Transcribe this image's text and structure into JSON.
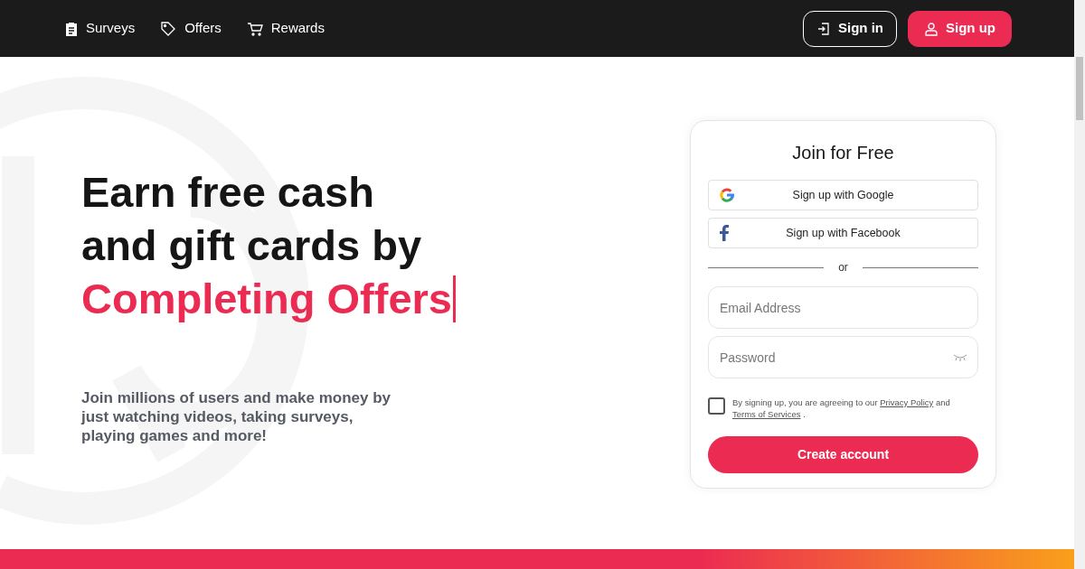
{
  "nav": {
    "items": [
      {
        "label": "Surveys",
        "kind": "clipboard"
      },
      {
        "label": "Offers",
        "kind": "tag"
      },
      {
        "label": "Rewards",
        "kind": "cart"
      }
    ],
    "sign_in": "Sign in",
    "sign_up": "Sign up"
  },
  "hero": {
    "headline_lines": [
      "Earn free cash",
      "and gift cards by"
    ],
    "highlight": "Completing Offers",
    "description": "Join millions of users and make money by just watching videos, taking surveys, playing games and more!"
  },
  "signup_card": {
    "title": "Join for Free",
    "social_buttons": [
      {
        "label": "Sign up with Google",
        "kind": "google"
      },
      {
        "label": "Sign up with Facebook",
        "kind": "facebook"
      }
    ],
    "divider": "or",
    "email": {
      "placeholder": "Email Address"
    },
    "password": {
      "placeholder": "Password"
    },
    "terms": {
      "checked": false,
      "prefix": "By signing up, you are agreeing to our",
      "privacy_link": "Privacy Policy",
      "middle": "and",
      "terms_link": "Terms of Services",
      "suffix": "."
    },
    "submit": "Create account"
  }
}
